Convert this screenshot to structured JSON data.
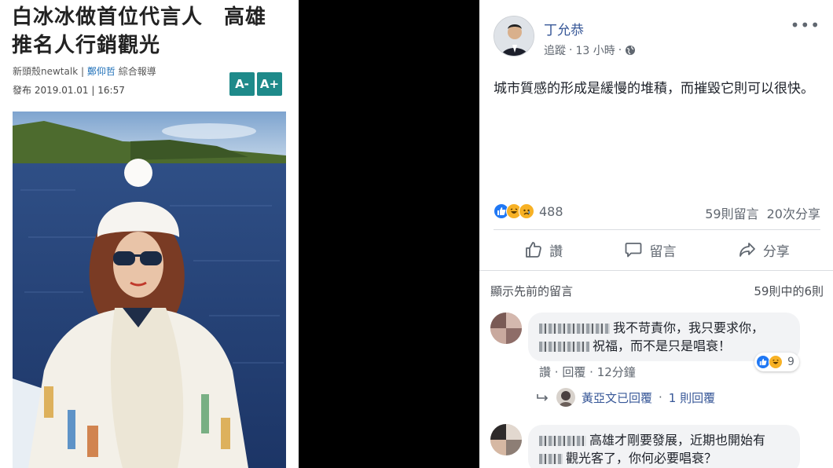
{
  "news": {
    "headline_line1": "白冰冰做首位代言人　高雄",
    "headline_line2": "推名人行銷觀光",
    "source": "新頭殼newtalk",
    "byline_sep1": "|",
    "author": "鄭仰哲",
    "report_type": "綜合報導",
    "publish_label": "發布",
    "publish_date": "2019.01.01",
    "byline_sep2": "|",
    "publish_time": "16:57",
    "font_smaller_label": "A-",
    "font_larger_label": "A+"
  },
  "post": {
    "author_name": "丁允恭",
    "follow_label": "追蹤",
    "dot": "·",
    "time_ago": "13 小時",
    "text": "城市質感的形成是緩慢的堆積，而摧毀它則可以很快。",
    "reaction_count": "488",
    "comments_count": "59則留言",
    "shares_count": "20次分享",
    "actions": {
      "like": "讚",
      "comment": "留言",
      "share": "分享"
    },
    "more_label": "•••",
    "colors": {
      "like": "#2078f4",
      "haha": "#f7b125",
      "sad": "#f7b125",
      "link": "#385898"
    }
  },
  "comments_section": {
    "show_previous": "顯示先前的留言",
    "range": "59則中的6則",
    "comments": [
      {
        "line1": "我不苛責你，我只要求你，",
        "line2": "祝福，而不是只是唱衰！",
        "like": "讚",
        "reply": "回覆",
        "time": "12分鐘",
        "reaction_count": "9",
        "reply_author": "黃亞文已回覆",
        "reply_count": "1 則回覆"
      },
      {
        "line1": "高雄才剛要發展，近期也開始有",
        "line2": "觀光客了，你何必要唱衰？"
      }
    ]
  }
}
